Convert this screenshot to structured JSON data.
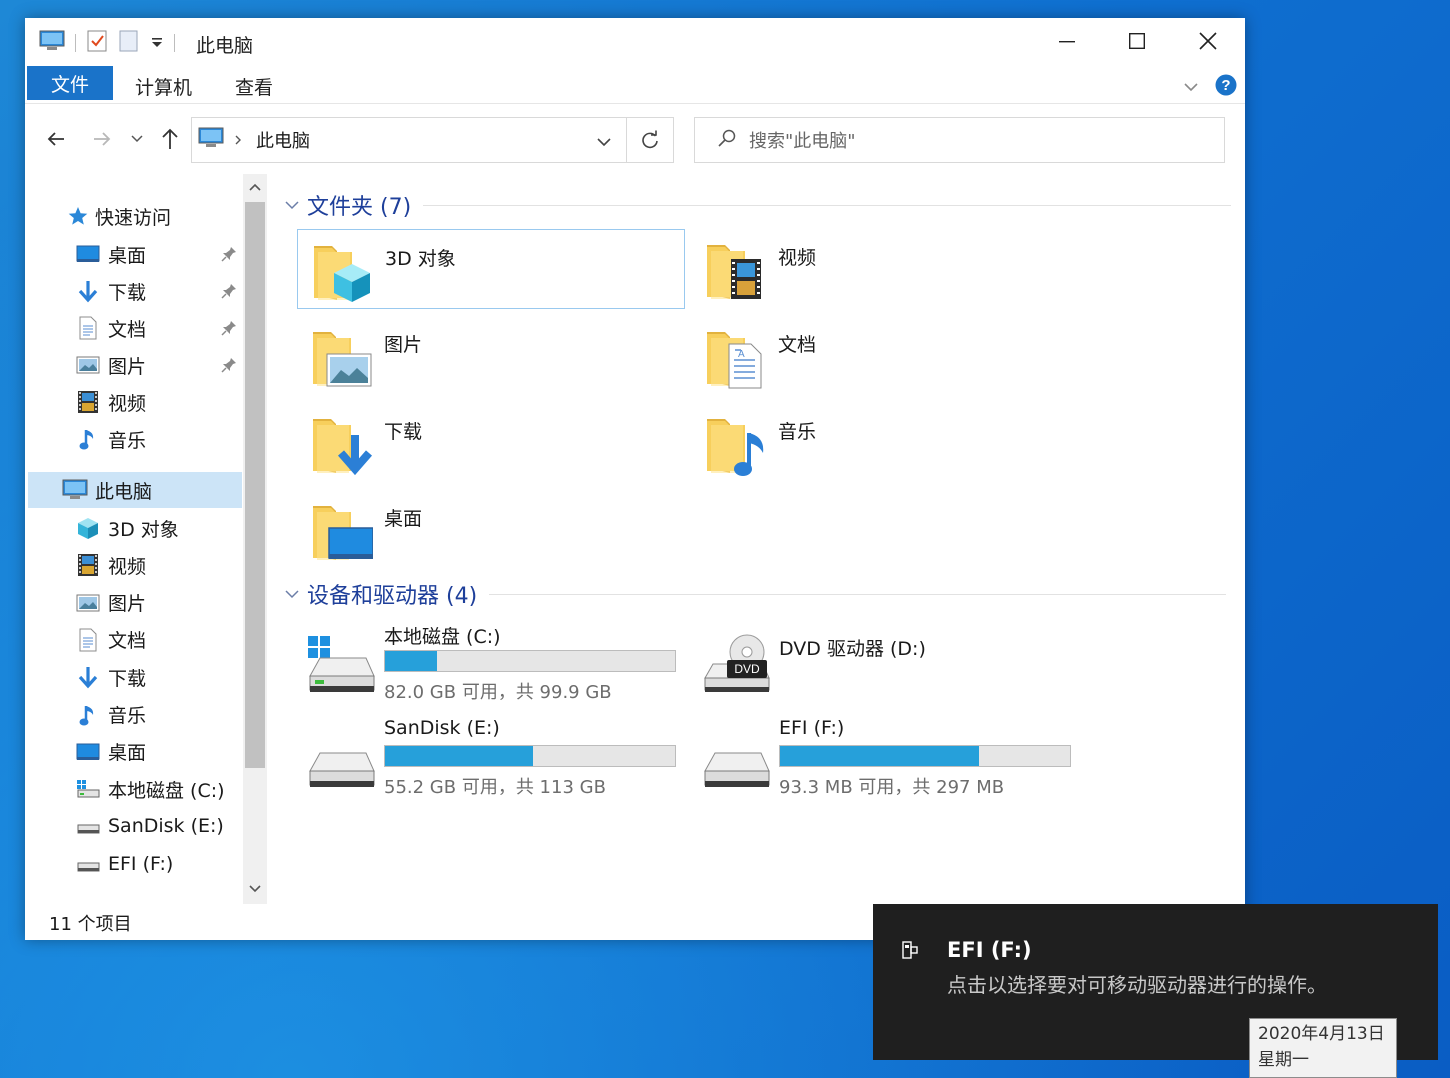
{
  "window": {
    "title": "此电脑"
  },
  "ribbon": {
    "tabs": [
      "文件",
      "计算机",
      "查看"
    ]
  },
  "address": {
    "path": "此电脑",
    "search_placeholder": "搜索\"此电脑\""
  },
  "sidebar": {
    "quick_access": "快速访问",
    "quick_items": [
      {
        "label": "桌面",
        "icon": "desktop-icon",
        "pinned": true
      },
      {
        "label": "下载",
        "icon": "download-icon",
        "pinned": true
      },
      {
        "label": "文档",
        "icon": "document-icon",
        "pinned": true
      },
      {
        "label": "图片",
        "icon": "picture-icon",
        "pinned": true
      },
      {
        "label": "视频",
        "icon": "video-icon",
        "pinned": false
      },
      {
        "label": "音乐",
        "icon": "music-icon",
        "pinned": false
      }
    ],
    "this_pc": "此电脑",
    "pc_items": [
      {
        "label": "3D 对象",
        "icon": "3d-objects-icon"
      },
      {
        "label": "视频",
        "icon": "video-icon"
      },
      {
        "label": "图片",
        "icon": "picture-icon"
      },
      {
        "label": "文档",
        "icon": "document-icon"
      },
      {
        "label": "下载",
        "icon": "download-icon"
      },
      {
        "label": "音乐",
        "icon": "music-icon"
      },
      {
        "label": "桌面",
        "icon": "desktop-icon"
      },
      {
        "label": "本地磁盘 (C:)",
        "icon": "windows-drive-icon"
      },
      {
        "label": "SanDisk (E:)",
        "icon": "drive-icon"
      },
      {
        "label": "EFI (F:)",
        "icon": "drive-icon"
      }
    ]
  },
  "main": {
    "folders_header": "文件夹 (7)",
    "folders": [
      {
        "name": "3D 对象",
        "icon": "3d-objects-folder-icon"
      },
      {
        "name": "视频",
        "icon": "video-folder-icon"
      },
      {
        "name": "图片",
        "icon": "picture-folder-icon"
      },
      {
        "name": "文档",
        "icon": "document-folder-icon"
      },
      {
        "name": "下载",
        "icon": "download-folder-icon"
      },
      {
        "name": "音乐",
        "icon": "music-folder-icon"
      },
      {
        "name": "桌面",
        "icon": "desktop-folder-icon"
      }
    ],
    "drives_header": "设备和驱动器 (4)",
    "drives": [
      {
        "name": "本地磁盘 (C:)",
        "info": "82.0 GB 可用，共 99.9 GB",
        "used_fraction": 0.179,
        "has_bar": true
      },
      {
        "name": "DVD 驱动器 (D:)",
        "info": "",
        "has_bar": false,
        "badge": "DVD"
      },
      {
        "name": "SanDisk (E:)",
        "info": "55.2 GB 可用，共 113 GB",
        "used_fraction": 0.511,
        "has_bar": true
      },
      {
        "name": "EFI (F:)",
        "info": "93.3 MB 可用，共 297 MB",
        "used_fraction": 0.686,
        "has_bar": true
      }
    ]
  },
  "status": {
    "count": "11 个项目"
  },
  "toast": {
    "title": "EFI (F:)",
    "body": "点击以选择要对可移动驱动器进行的操作。"
  },
  "clock_tooltip": {
    "date": "2020年4月13日",
    "weekday": "星期一"
  },
  "colors": {
    "accent": "#1a73c9",
    "bar_fill": "#26a0da",
    "group_header": "#1e3f9a"
  }
}
